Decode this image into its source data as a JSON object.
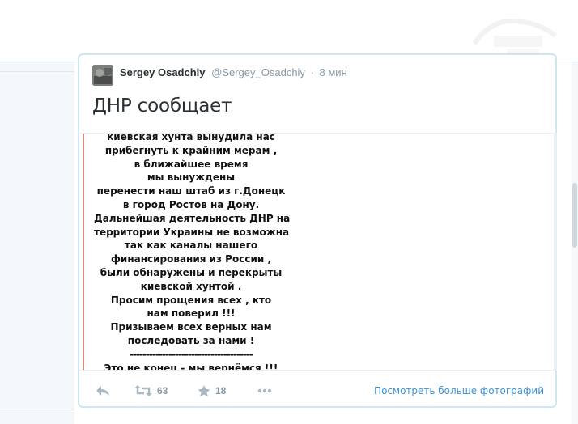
{
  "tweet": {
    "author_name": "Sergey Osadchiy",
    "author_handle": "@Sergey_Osadchiy",
    "separator": "·",
    "time": "8 мин",
    "text": "ДНР сообщает",
    "media_text": [
      "киевская хунта вынудила нас",
      "прибегнуть к крайним мерам ,",
      "в ближайшее время",
      "мы вынуждены",
      "перенести наш штаб из г.Донецк",
      "в город Ростов на Дону.",
      "Дальнейшая деятельность ДНР на",
      "территории Украины не возможна",
      "так как каналы нашего",
      "финансирования из России ,",
      "были обнаружены и перекрыты",
      "киевской хунтой .",
      "Просим прощения всех , кто",
      "нам поверил !!!",
      "Призываем всех верных нам",
      "последовать за нами !",
      "--------------------------------------",
      "Это не конец - мы вернёмся !!!"
    ],
    "actions": {
      "reply_icon": "reply-icon",
      "retweet_icon": "retweet-icon",
      "retweet_count": "63",
      "favorite_icon": "star-icon",
      "favorite_count": "18",
      "more_icon": "more-dots-icon"
    },
    "see_more_photos": "Посмотреть больше фотографий"
  },
  "colors": {
    "border": "#cfe6ef",
    "link": "#3b94d9",
    "muted": "#8899a6"
  }
}
